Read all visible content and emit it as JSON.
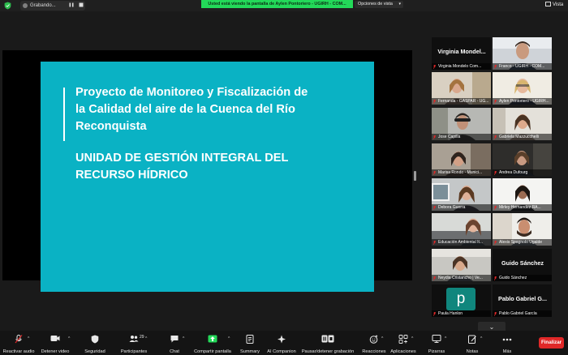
{
  "topbar": {
    "recording_label": "Grabando...",
    "share_banner": "Usted está viendo la pantalla de Aylen Pontoriero - UGIRH - COM...",
    "view_options": "Opciones de vista",
    "view_label": "Vista"
  },
  "slide": {
    "title": "Proyecto de Monitoreo y Fiscalización de la Calidad del aire de la Cuenca del Río Reconquista",
    "subtitle": "UNIDAD DE GESTIÓN INTEGRAL DEL RECURSO HÍDRICO"
  },
  "gallery": [
    {
      "label": "Virginia Mondelo Com...",
      "big": "Virginia Mondel...",
      "video": false
    },
    {
      "label": "Franco - UGIRH - COM...",
      "video": true
    },
    {
      "label": "Fernanda - GASPAR - UG...",
      "video": true
    },
    {
      "label": "Aylen Pontoriero - UGIRH...",
      "video": true,
      "active": true
    },
    {
      "label": "Jose Capilla",
      "video": true
    },
    {
      "label": "Gabriela Mazzucchelli",
      "video": true
    },
    {
      "label": "Marisa Rondo - Munici...",
      "video": true
    },
    {
      "label": "Andrea Dufourg",
      "video": true
    },
    {
      "label": "Debora Guerra",
      "video": true
    },
    {
      "label": "Mirley Hernandez RA...",
      "video": true
    },
    {
      "label": "Educación Ambiental It...",
      "video": true
    },
    {
      "label": "Alexis Spagnolo Ugalde",
      "video": true
    },
    {
      "label": "Neydia Cristancho | Ve...",
      "video": true
    },
    {
      "label": "Guido Sánchez",
      "big": "Guido Sánchez",
      "video": false
    },
    {
      "label": "Paula Hanlon",
      "avatar": "p",
      "video": false
    },
    {
      "label": "Pablo Gabriel García",
      "big": "Pablo Gabriel G...",
      "video": false
    }
  ],
  "controls": [
    {
      "label": "Reactivar audio",
      "icon": "mic-muted-icon"
    },
    {
      "label": "Detener video",
      "icon": "video-camera-icon"
    },
    {
      "label": "Seguridad",
      "icon": "shield-icon"
    },
    {
      "label": "Participantes",
      "icon": "participants-icon",
      "count": "29"
    },
    {
      "label": "Chat",
      "icon": "chat-icon"
    },
    {
      "label": "Compartir pantalla",
      "icon": "share-screen-icon"
    },
    {
      "label": "Summary",
      "icon": "summary-icon"
    },
    {
      "label": "AI Companion",
      "icon": "ai-sparkle-icon"
    },
    {
      "label": "Pausar/detener grabación",
      "icon": "pause-stop-recording-icon"
    },
    {
      "label": "Reacciones",
      "icon": "reactions-icon"
    },
    {
      "label": "Aplicaciones",
      "icon": "apps-icon"
    },
    {
      "label": "Pizarras",
      "icon": "whiteboard-icon"
    },
    {
      "label": "Notas",
      "icon": "notes-icon"
    },
    {
      "label": "Más",
      "icon": "more-icon"
    }
  ],
  "end_button": "Finalizar",
  "colors": {
    "banner_green": "#23d959",
    "share_green": "#23d959",
    "slide_teal": "#0ab2c4",
    "end_red": "#e02828",
    "active_tile": "#e4ec52",
    "muted_mic_red": "#e02828"
  }
}
